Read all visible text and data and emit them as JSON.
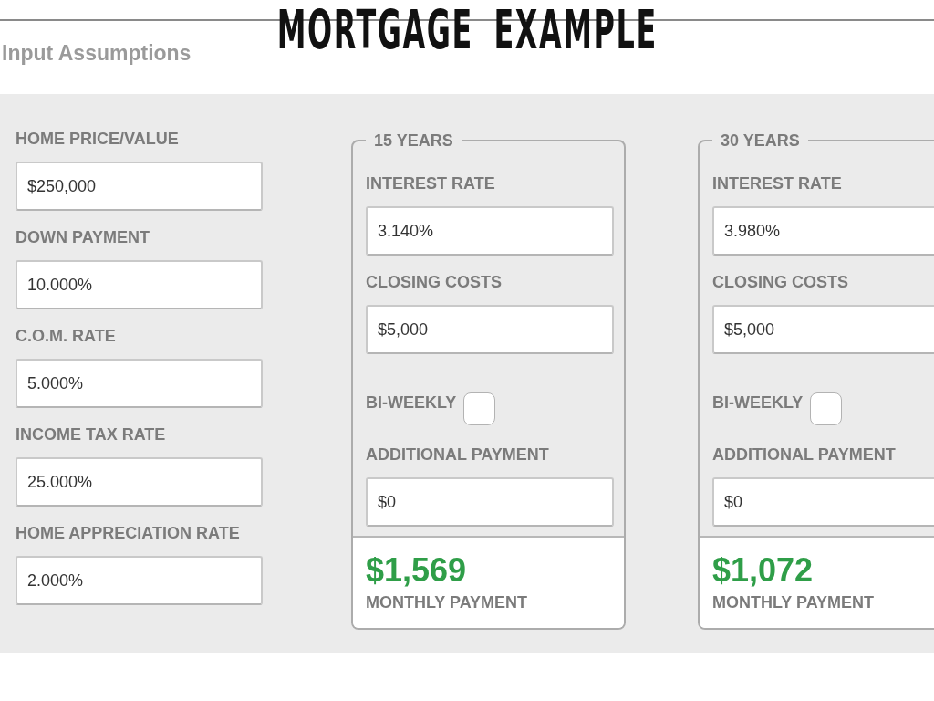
{
  "slide": {
    "title": "MORTGAGE EXAMPLE"
  },
  "section": {
    "title": "Input Assumptions"
  },
  "assumptions": [
    {
      "label": "HOME PRICE/VALUE",
      "value": "$250,000"
    },
    {
      "label": "DOWN PAYMENT",
      "value": "10.000%"
    },
    {
      "label": "C.O.M. RATE",
      "value": "5.000%"
    },
    {
      "label": "INCOME TAX RATE",
      "value": "25.000%"
    },
    {
      "label": "HOME APPRECIATION RATE",
      "value": "2.000%"
    }
  ],
  "terms": [
    {
      "legend": "15 YEARS",
      "fields": [
        {
          "kind": "input",
          "label": "INTEREST RATE",
          "value": "3.140%"
        },
        {
          "kind": "input",
          "label": "CLOSING COSTS",
          "value": "$5,000"
        },
        {
          "kind": "checkbox",
          "label": "BI-WEEKLY",
          "checked": false
        },
        {
          "kind": "input",
          "label": "ADDITIONAL PAYMENT",
          "value": "$0"
        }
      ],
      "result": {
        "amount": "$1,569",
        "label": "MONTHLY PAYMENT"
      }
    },
    {
      "legend": "30 YEARS",
      "fields": [
        {
          "kind": "input",
          "label": "INTEREST RATE",
          "value": "3.980%"
        },
        {
          "kind": "input",
          "label": "CLOSING COSTS",
          "value": "$5,000"
        },
        {
          "kind": "checkbox",
          "label": "BI-WEEKLY",
          "checked": false
        },
        {
          "kind": "input",
          "label": "ADDITIONAL PAYMENT",
          "value": "$0"
        }
      ],
      "result": {
        "amount": "$1,072",
        "label": "MONTHLY PAYMENT"
      }
    }
  ]
}
